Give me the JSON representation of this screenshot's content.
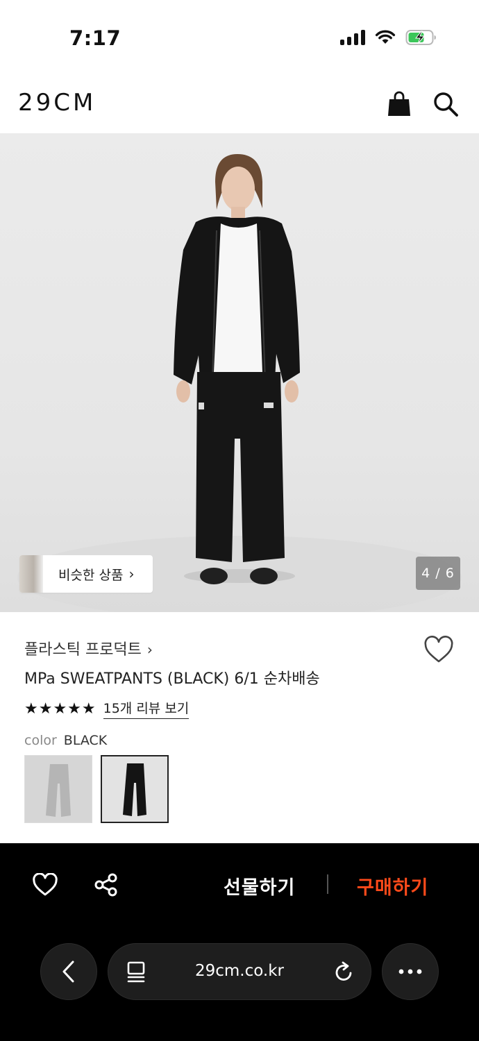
{
  "status_bar": {
    "time": "7:17"
  },
  "header": {
    "logo": "29CM",
    "icons": [
      "shopping-bag-icon",
      "search-icon"
    ]
  },
  "hero": {
    "similar_products_label": "비슷한 상품",
    "similar_products_chevron": "›",
    "page_indicator": "4 / 6"
  },
  "product": {
    "brand": "플라스틱 프로덕트",
    "brand_chevron": "›",
    "name": "MPa SWEATPANTS (BLACK) 6/1 순차배송",
    "rating_stars": "★★★★★",
    "rating_value": 5,
    "review_link": "15개 리뷰 보기",
    "color_label": "color",
    "color_value": "BLACK",
    "color_options": [
      "grey",
      "black"
    ],
    "selected_color_index": 1
  },
  "action_bar": {
    "gift_label": "선물하기",
    "buy_label": "구매하기",
    "buy_color": "#ff4a1a"
  },
  "browser": {
    "url": "29cm.co.kr"
  }
}
